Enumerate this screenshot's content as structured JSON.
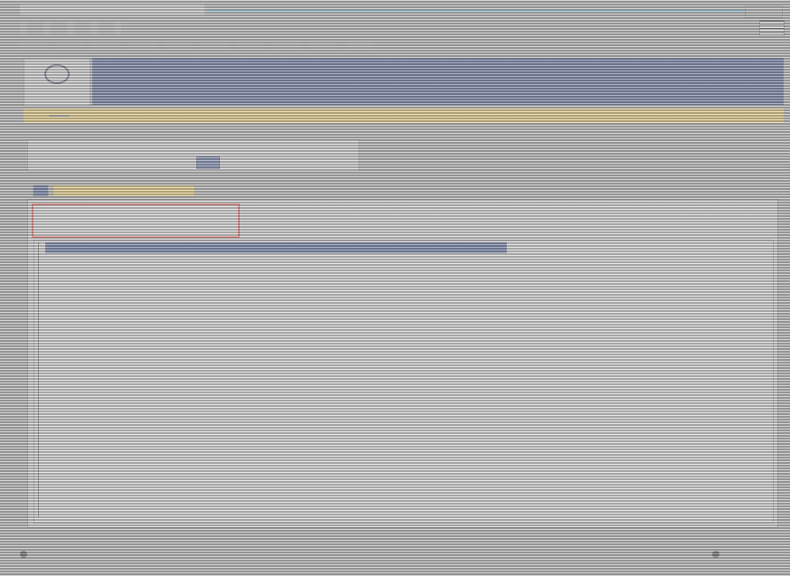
{
  "window": {
    "title": ""
  },
  "menu": {
    "items": [
      "",
      "",
      "",
      "",
      ""
    ]
  },
  "header": {
    "logo_text": ""
  },
  "nav": {
    "items": [
      "",
      "",
      "",
      "",
      "",
      "",
      "",
      ""
    ]
  },
  "filter": {
    "label1": "",
    "label2": "",
    "label3": "",
    "label4": ""
  },
  "tabs": {
    "active": "",
    "inactive": ""
  },
  "range": {
    "from": "",
    "sep": "",
    "to": ""
  },
  "grid": {
    "header": ""
  },
  "footer": {
    "left": "",
    "right": ""
  },
  "colors": {
    "nav": "#d7b85d",
    "banner": "#3f5183",
    "highlight": "#c8413a"
  }
}
